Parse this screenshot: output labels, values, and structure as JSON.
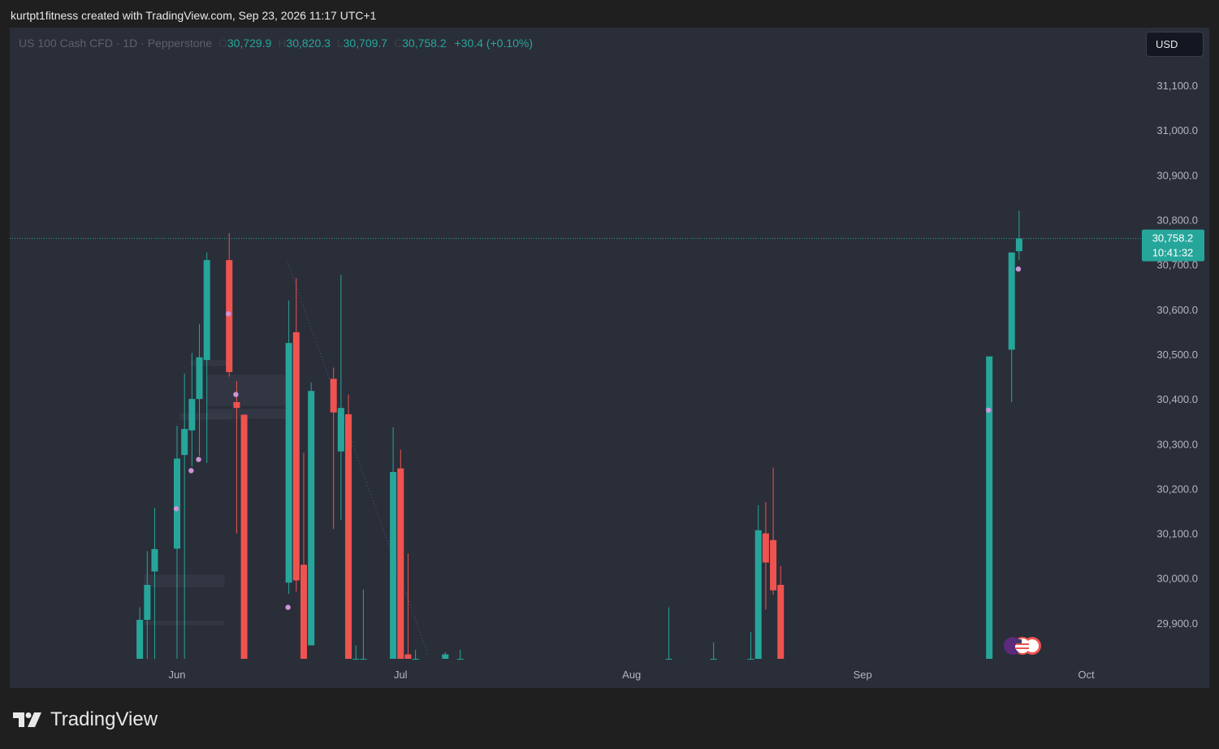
{
  "header": {
    "attribution": "kurtpt1fitness created with TradingView.com, Sep 23, 2026 11:17 UTC+1"
  },
  "legend": {
    "symbol": "US 100 Cash CFD · 1D · Pepperstone",
    "o_label": "O",
    "o_value": "30,729.9",
    "h_label": "H",
    "h_value": "30,820.3",
    "l_label": "L",
    "l_value": "30,709.7",
    "c_label": "C",
    "c_value": "30,758.2",
    "change": "+30.4 (+0.10%)"
  },
  "currency_button": "USD",
  "price_tag": {
    "price": "30,758.2",
    "countdown": "10:41:32"
  },
  "brand": {
    "name": "TradingView"
  },
  "colors": {
    "up": "#26a69a",
    "down": "#ef5350",
    "background": "#2a2e39",
    "frame": "#1f1f1f",
    "axis_text": "#b2b5be",
    "marker": "#ce93d8"
  },
  "chart_data": {
    "type": "candlestick",
    "title": "US 100 Cash CFD · 1D · Pepperstone",
    "ylim": [
      29820,
      31190
    ],
    "y_ticks": [
      "29,900.0",
      "30,000.0",
      "30,100.0",
      "30,200.0",
      "30,300.0",
      "30,400.0",
      "30,500.0",
      "30,600.0",
      "30,700.0",
      "30,800.0",
      "30,900.0",
      "31,000.0",
      "31,100.0"
    ],
    "x_labels": [
      "Jun",
      "Jul",
      "Aug",
      "Sep",
      "Oct"
    ],
    "last_price": 30758.2,
    "candles": [
      {
        "date": "2026-05-27",
        "o": 29820,
        "h": 29935,
        "l": 29820,
        "c": 29907
      },
      {
        "date": "2026-05-28",
        "o": 29907,
        "h": 30060,
        "l": 29820,
        "c": 29985
      },
      {
        "date": "2026-05-29",
        "o": 30015,
        "h": 30157,
        "l": 29820,
        "c": 30065
      },
      {
        "date": "2026-06-01",
        "o": 30066,
        "h": 30340,
        "l": 29820,
        "c": 30267
      },
      {
        "date": "2026-06-02",
        "o": 30275,
        "h": 30457,
        "l": 29820,
        "c": 30333
      },
      {
        "date": "2026-06-03",
        "o": 30330,
        "h": 30503,
        "l": 30250,
        "c": 30400
      },
      {
        "date": "2026-06-04",
        "o": 30400,
        "h": 30567,
        "l": 30273,
        "c": 30493
      },
      {
        "date": "2026-06-05",
        "o": 30487,
        "h": 30727,
        "l": 30257,
        "c": 30710
      },
      {
        "date": "2026-06-08",
        "o": 30710,
        "h": 30770,
        "l": 30450,
        "c": 30460
      },
      {
        "date": "2026-06-09",
        "o": 30393,
        "h": 30440,
        "l": 30100,
        "c": 30380
      },
      {
        "date": "2026-06-10",
        "o": 30365,
        "h": 30365,
        "l": 29820,
        "c": 29820
      },
      {
        "date": "2026-06-16",
        "o": 29990,
        "h": 30620,
        "l": 29965,
        "c": 30525
      },
      {
        "date": "2026-06-17",
        "o": 30549,
        "h": 30670,
        "l": 29970,
        "c": 29995
      },
      {
        "date": "2026-06-18",
        "o": 30030,
        "h": 30280,
        "l": 29820,
        "c": 29820
      },
      {
        "date": "2026-06-19",
        "o": 29850,
        "h": 30437,
        "l": 29850,
        "c": 30418
      },
      {
        "date": "2026-06-22",
        "o": 30445,
        "h": 30470,
        "l": 30110,
        "c": 30370
      },
      {
        "date": "2026-06-23",
        "o": 30283,
        "h": 30677,
        "l": 30130,
        "c": 30380
      },
      {
        "date": "2026-06-24",
        "o": 30366,
        "h": 30410,
        "l": 29820,
        "c": 29820
      },
      {
        "date": "2026-06-25",
        "o": 29820,
        "h": 29850,
        "l": 29820,
        "c": 29820
      },
      {
        "date": "2026-06-26",
        "o": 29820,
        "h": 29975,
        "l": 29820,
        "c": 29820
      },
      {
        "date": "2026-06-30",
        "o": 29820,
        "h": 30337,
        "l": 29820,
        "c": 30237
      },
      {
        "date": "2026-07-01",
        "o": 30245,
        "h": 30287,
        "l": 29820,
        "c": 29820
      },
      {
        "date": "2026-07-02",
        "o": 29830,
        "h": 30055,
        "l": 29820,
        "c": 29820
      },
      {
        "date": "2026-07-03",
        "o": 29820,
        "h": 29840,
        "l": 29820,
        "c": 29820
      },
      {
        "date": "2026-07-07",
        "o": 29820,
        "h": 29835,
        "l": 29820,
        "c": 29830
      },
      {
        "date": "2026-07-09",
        "o": 29820,
        "h": 29840,
        "l": 29820,
        "c": 29820
      },
      {
        "date": "2026-08-06",
        "o": 29820,
        "h": 29935,
        "l": 29820,
        "c": 29820
      },
      {
        "date": "2026-08-12",
        "o": 29820,
        "h": 29857,
        "l": 29820,
        "c": 29820
      },
      {
        "date": "2026-08-17",
        "o": 29820,
        "h": 29880,
        "l": 29820,
        "c": 29820
      },
      {
        "date": "2026-08-18",
        "o": 29820,
        "h": 30163,
        "l": 29820,
        "c": 30107
      },
      {
        "date": "2026-08-19",
        "o": 30100,
        "h": 30170,
        "l": 29930,
        "c": 30035
      },
      {
        "date": "2026-08-20",
        "o": 30085,
        "h": 30247,
        "l": 29963,
        "c": 29973
      },
      {
        "date": "2026-08-21",
        "o": 29985,
        "h": 30027,
        "l": 29820,
        "c": 29820
      },
      {
        "date": "2026-09-18",
        "o": 29820,
        "h": 29820,
        "l": 29820,
        "c": 30495
      },
      {
        "date": "2026-09-21",
        "o": 30510,
        "h": 30560,
        "l": 30393,
        "c": 30727
      },
      {
        "date": "2026-09-22",
        "o": 30729.9,
        "h": 30820.3,
        "l": 30709.7,
        "c": 30758.2
      }
    ],
    "markers": [
      {
        "date": "2026-06-01",
        "price": 30155
      },
      {
        "date": "2026-06-03",
        "price": 30240
      },
      {
        "date": "2026-06-04",
        "price": 30265
      },
      {
        "date": "2026-06-08",
        "price": 30590
      },
      {
        "date": "2026-06-09",
        "price": 30410
      },
      {
        "date": "2026-06-16",
        "price": 29935
      },
      {
        "date": "2026-09-18",
        "price": 30375
      },
      {
        "date": "2026-09-22",
        "price": 30690
      }
    ]
  }
}
